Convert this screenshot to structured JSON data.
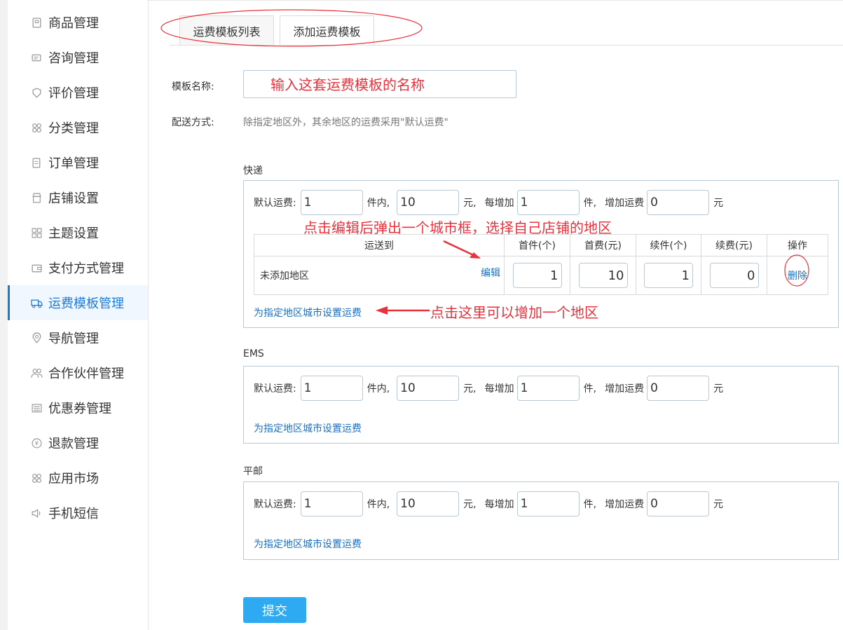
{
  "sidebar": {
    "items": [
      {
        "label": "商品管理",
        "icon": "product-icon"
      },
      {
        "label": "咨询管理",
        "icon": "chat-icon"
      },
      {
        "label": "评价管理",
        "icon": "review-icon"
      },
      {
        "label": "分类管理",
        "icon": "category-icon"
      },
      {
        "label": "订单管理",
        "icon": "order-icon"
      },
      {
        "label": "店铺设置",
        "icon": "shop-icon"
      },
      {
        "label": "主题设置",
        "icon": "theme-icon"
      },
      {
        "label": "支付方式管理",
        "icon": "wallet-icon"
      },
      {
        "label": "运费模板管理",
        "icon": "truck-icon",
        "active": true
      },
      {
        "label": "导航管理",
        "icon": "location-icon"
      },
      {
        "label": "合作伙伴管理",
        "icon": "partners-icon"
      },
      {
        "label": "优惠券管理",
        "icon": "coupon-icon"
      },
      {
        "label": "退款管理",
        "icon": "refund-icon"
      },
      {
        "label": "应用市场",
        "icon": "apps-icon"
      },
      {
        "label": "手机短信",
        "icon": "speaker-icon"
      }
    ]
  },
  "tabs": [
    {
      "label": "运费模板列表"
    },
    {
      "label": "添加运费模板",
      "active": true
    }
  ],
  "form": {
    "template_name_label": "模板名称:",
    "template_name_value": "",
    "delivery_label": "配送方式:",
    "delivery_hint": "除指定地区外，其余地区的运费采用\"默认运费\""
  },
  "annotations": {
    "name_hint": "输入这套运费模板的名称",
    "edit_hint": "点击编辑后弹出一个城市框，选择自己店铺的地区",
    "add_area_hint": "点击这里可以增加一个地区",
    "color": "#e8323c"
  },
  "fee_labels": {
    "default_fee": "默认运费:",
    "items_within": "件内,",
    "yuan_comma": "元,",
    "each_add": "每增加",
    "items_comma": "件,",
    "add_fee": "增加运费",
    "yuan": "元"
  },
  "sections": [
    {
      "title": "快递",
      "first_items": "1",
      "first_fee": "10",
      "add_items": "1",
      "add_fee": "0",
      "table": {
        "headers": [
          "运送到",
          "首件(个)",
          "首费(元)",
          "续件(个)",
          "续费(元)",
          "操作"
        ],
        "row": {
          "area": "未添加地区",
          "edit": "编辑",
          "first_items": "1",
          "first_fee": "10",
          "add_items": "1",
          "add_fee": "0",
          "delete": "删除"
        }
      },
      "add_link": "为指定地区城市设置运费"
    },
    {
      "title": "EMS",
      "first_items": "1",
      "first_fee": "10",
      "add_items": "1",
      "add_fee": "0",
      "add_link": "为指定地区城市设置运费"
    },
    {
      "title": "平邮",
      "first_items": "1",
      "first_fee": "10",
      "add_items": "1",
      "add_fee": "0",
      "add_link": "为指定地区城市设置运费"
    }
  ],
  "submit_label": "提交",
  "colors": {
    "accent": "#1b7ad8",
    "link": "#1b6ec2",
    "submit": "#2eaaf2"
  }
}
